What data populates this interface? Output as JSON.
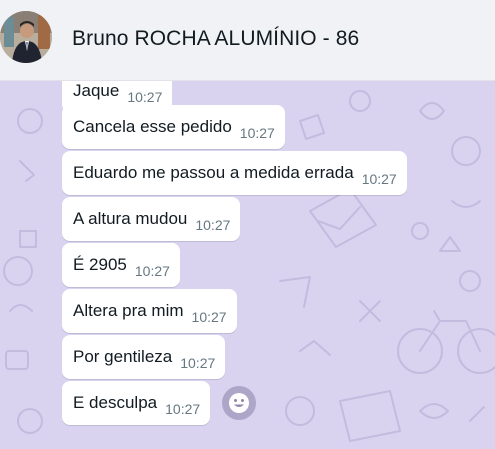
{
  "header": {
    "contact_name": "Bruno ROCHA ALUMÍNIO - 86",
    "avatar_icon": "contact-photo"
  },
  "messages": [
    {
      "text": "Jaque",
      "time": "10:27"
    },
    {
      "text": "Cancela esse pedido",
      "time": "10:27"
    },
    {
      "text": "Eduardo me passou a medida errada",
      "time": "10:27"
    },
    {
      "text": "A altura mudou",
      "time": "10:27"
    },
    {
      "text": "É 2905",
      "time": "10:27"
    },
    {
      "text": "Altera pra mim",
      "time": "10:27"
    },
    {
      "text": "Por gentileza",
      "time": "10:27"
    },
    {
      "text": "E desculpa",
      "time": "10:27"
    }
  ],
  "reaction_button_icon": "smiley-icon",
  "colors": {
    "header_bg": "#f0f2f5",
    "chat_bg": "#d9d3f0",
    "bubble_bg": "#ffffff",
    "text": "#111b21",
    "timestamp": "#667781"
  }
}
